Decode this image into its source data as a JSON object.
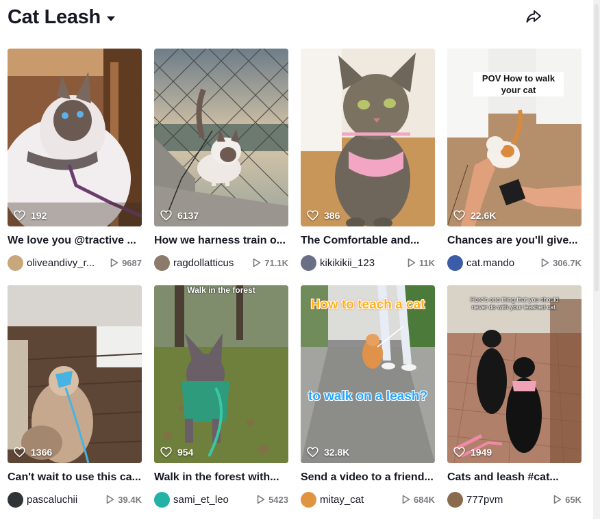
{
  "page": {
    "title": "Cat Leash"
  },
  "videos": [
    {
      "likes": "192",
      "caption": "We love you @tractive ...",
      "username": "oliveandivy_r...",
      "views": "9687",
      "avatar_color": "#c9a77c",
      "overlay": ""
    },
    {
      "likes": "6137",
      "caption": "How we harness train o...",
      "username": "ragdollatticus",
      "views": "71.1K",
      "avatar_color": "#8c7a6a",
      "overlay": ""
    },
    {
      "likes": "386",
      "caption": "The Comfortable and...",
      "username": "kikikikii_123",
      "views": "11K",
      "avatar_color": "#6b6f86",
      "overlay": ""
    },
    {
      "likes": "22.6K",
      "caption": "Chances are you'll give...",
      "username": "cat.mando",
      "views": "306.7K",
      "avatar_color": "#3b5da8",
      "overlay": "POV How to walk your cat"
    },
    {
      "likes": "1366",
      "caption": "Can't wait to use this ca...",
      "username": "pascaluchii",
      "views": "39.4K",
      "avatar_color": "#2f3437",
      "overlay": ""
    },
    {
      "likes": "954",
      "caption": "Walk in the forest with...",
      "username": "sami_et_leo",
      "views": "5423",
      "avatar_color": "#22b3a6",
      "overlay": "Walk in the forest"
    },
    {
      "likes": "32.8K",
      "caption": "Send a video to a friend...",
      "username": "mitay_cat",
      "views": "684K",
      "avatar_color": "#e09442",
      "overlay": "How to teach a cat",
      "overlay2": "to walk on a leash?"
    },
    {
      "likes": "1949",
      "caption": "Cats and leash #cat...",
      "username": "777pvm",
      "views": "65K",
      "avatar_color": "#8a6b4e",
      "overlay": "Here's one thing that you should never do with your leashed cat."
    }
  ]
}
